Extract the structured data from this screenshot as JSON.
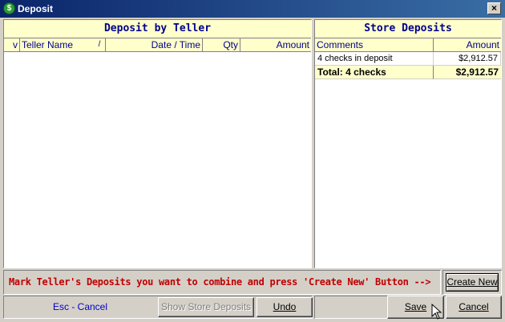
{
  "window": {
    "title": "Deposit",
    "icon": "dollar-icon",
    "close_label": "×"
  },
  "left_panel": {
    "title": "Deposit by Teller",
    "columns": [
      "v",
      "Teller Name",
      "/",
      "Date / Time",
      "Qty",
      "Amount"
    ]
  },
  "right_panel": {
    "title": "Store Deposits",
    "columns": [
      "Comments",
      "Amount"
    ],
    "rows": [
      {
        "comments": "4 checks in deposit",
        "amount": "$2,912.57"
      }
    ],
    "total": {
      "label": "Total: 4 checks",
      "amount": "$2,912.57"
    }
  },
  "instruction": "Mark Teller's Deposits you want to combine and press 'Create New' Button -->",
  "buttons": {
    "create_new": "Create New",
    "esc_cancel": "Esc - Cancel",
    "show_store_deposits": "Show Store Deposits",
    "undo": "Undo",
    "save": "Save",
    "cancel": "Cancel"
  },
  "colors": {
    "header_bg": "#ffffcc",
    "header_text": "#00008b",
    "instruction_text": "#c00000",
    "esc_text": "#0000cc"
  }
}
